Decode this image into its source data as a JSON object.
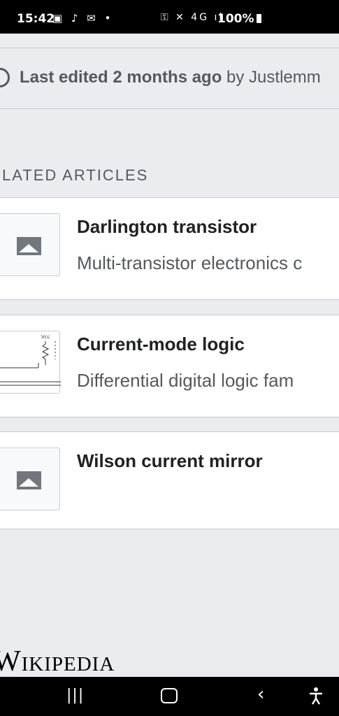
{
  "status_bar": {
    "time": "15:42",
    "left_icons": "▣ ♪ ✉ •",
    "right_icons": "⚿ ✕ 4G ıl",
    "battery": "100%"
  },
  "last_edited": {
    "prefix": "Last edited 2 months ago",
    "by": " by Justlemm"
  },
  "related_heading": "LATED ARTICLES",
  "related_articles": [
    {
      "title": "Darlington transistor",
      "description": "Multi-transistor electronics c",
      "thumbnail": "image-placeholder-icon"
    },
    {
      "title": "Current-mode logic",
      "description": "Differential digital logic fam",
      "thumbnail": "circuit-diagram"
    },
    {
      "title": "Wilson current mirror",
      "description": "",
      "thumbnail": "image-placeholder-icon"
    }
  ],
  "footer_logo": "Wikipedia",
  "nav_bar": {
    "recents": "|||",
    "back": "‹",
    "accessibility": "☥"
  }
}
